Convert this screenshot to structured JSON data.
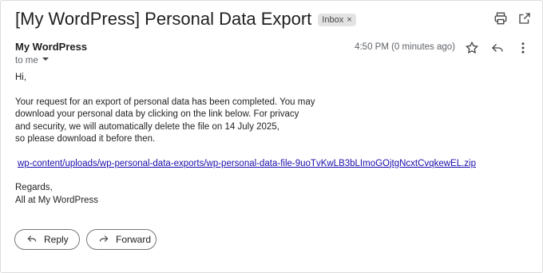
{
  "email": {
    "subject": "[My WordPress] Personal Data Export",
    "label": "Inbox",
    "label_close": "×",
    "sender": "My WordPress",
    "recipient": "to me",
    "time": "4:50 PM (0 minutes ago)",
    "greeting": "Hi,",
    "body_lines": [
      "Your request for an export of personal data has been completed. You may",
      "download your personal data by clicking on the link below. For privacy",
      "and security, we will automatically delete the file on 14 July 2025,",
      "so please download it before then."
    ],
    "link": "wp-content/uploads/wp-personal-data-exports/wp-personal-data-file-9uoTvKwLB3bLImoGOjtgNcxtCvqkewEL.zip",
    "signoff": "Regards,",
    "signature": "All at My WordPress"
  },
  "actions": {
    "reply_label": "Reply",
    "forward_label": "Forward"
  },
  "icons": [
    "print-icon",
    "open-in-new-icon",
    "star-icon",
    "reply-icon",
    "more-vert-icon",
    "dropdown-arrow-icon",
    "forward-icon"
  ]
}
